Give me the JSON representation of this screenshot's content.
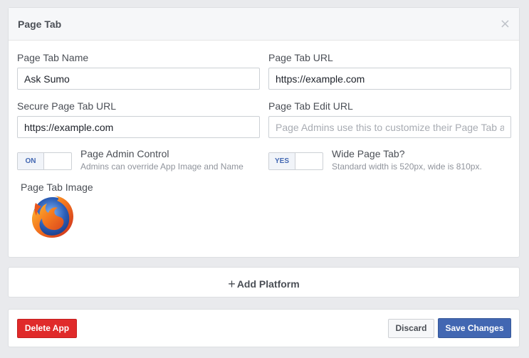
{
  "panel": {
    "title": "Page Tab",
    "close_glyph": "×",
    "fields": {
      "page_tab_name": {
        "label": "Page Tab Name",
        "value": "Ask Sumo"
      },
      "page_tab_url": {
        "label": "Page Tab URL",
        "value": "https://example.com"
      },
      "secure_page_tab_url": {
        "label": "Secure Page Tab URL",
        "value": "https://example.com"
      },
      "page_tab_edit_url": {
        "label": "Page Tab Edit URL",
        "value": "",
        "placeholder": "Page Admins use this to customize their Page Tab app"
      }
    },
    "admin_control": {
      "state": "ON",
      "title": "Page Admin Control",
      "description": "Admins can override App Image and Name"
    },
    "wide_tab": {
      "state": "YES",
      "title": "Wide Page Tab?",
      "description": "Standard width is 520px, wide is 810px."
    },
    "image": {
      "label": "Page Tab Image",
      "icon": "firefox-logo-icon"
    }
  },
  "add_platform": {
    "plus": "+",
    "label": "Add Platform"
  },
  "footer": {
    "delete_label": "Delete App",
    "discard_label": "Discard",
    "save_label": "Save Changes"
  },
  "colors": {
    "primary": "#4267b2",
    "danger": "#e02a2a",
    "background": "#e9eaed"
  }
}
